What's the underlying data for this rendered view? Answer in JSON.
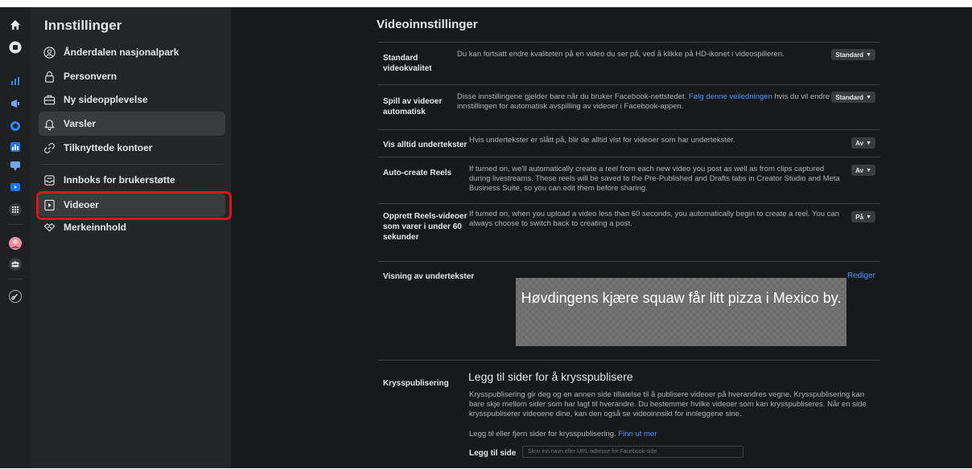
{
  "sidebar": {
    "title": "Innstillinger",
    "items": [
      {
        "label": "Ånderdalen nasjonalpark",
        "icon": "user-circle-icon"
      },
      {
        "label": "Personvern",
        "icon": "lock-icon"
      },
      {
        "label": "Ny sideopplevelse",
        "icon": "briefcase-icon"
      },
      {
        "label": "Varsler",
        "icon": "bell-icon"
      },
      {
        "label": "Tilknyttede kontoer",
        "icon": "link-icon"
      },
      {
        "label": "Innboks for brukerstøtte",
        "icon": "inbox-icon"
      },
      {
        "label": "Videoer",
        "icon": "video-icon"
      },
      {
        "label": "Merkeinnhold",
        "icon": "handshake-icon"
      }
    ]
  },
  "main": {
    "title": "Videoinnstillinger",
    "rows": [
      {
        "label": "Standard videokvalitet",
        "description": "Du kan fortsatt endre kvaliteten på en video du ser på, ved å klikke på HD-ikonet i videospilleren.",
        "value": "Standard"
      },
      {
        "label": "Spill av videoer automatisk",
        "description_before": "Disse innstillingene gjelder bare når du bruker Facebook-nettstedet. ",
        "description_link": "Følg denne veiledningen",
        "description_after": " hvis du vil endre innstillingen for automatisk avspilling av videoer i Facebook-appen.",
        "value": "Standard"
      },
      {
        "label": "Vis alltid undertekster",
        "description": "Hvis undertekster er slått på, blir de alltid vist for videoer som har undertekster.",
        "value": "Av"
      },
      {
        "label": "Auto-create Reels",
        "description": "If turned on, we'll automatically create a reel from each new video you post as well as from clips captured during livestreams. These reels will be saved to the Pre-Published and Drafts tabs in Creator Studio and Meta Business Suite, so you can edit them before sharing.",
        "value": "Av"
      },
      {
        "label": "Opprett Reels-videoer som varer i under 60 sekunder",
        "description": "If turned on, when you upload a video less than 60 seconds, you automatically begin to create a reel. You can always choose to switch back to creating a post.",
        "value": "På"
      }
    ],
    "subtitles": {
      "label": "Visning av undertekster",
      "edit": "Rediger",
      "preview": "Høvdingens kjære squaw får litt pizza i Mexico by."
    },
    "crosspost": {
      "label": "Krysspublisering",
      "title": "Legg til sider for å krysspublisere",
      "text": "Krysspublisering gir deg og en annen side tillatelse til å publisere videoer på hverandres vegne. Krysspublisering kan bare skje mellom sider som har lagt til hverandre. Du bestemmer hvilke videoer som kan krysspubliseres. Når en side krysspubliserer videoene dine, kan den også se videoinnsikt for innleggene sine.",
      "manage_text": "Legg til eller fjern sider for krysspublisering. ",
      "learn_more": "Finn ut mer",
      "add_label": "Legg til side",
      "input_placeholder": "Skriv inn navn eller URL-adresse for Facebook-side"
    }
  }
}
